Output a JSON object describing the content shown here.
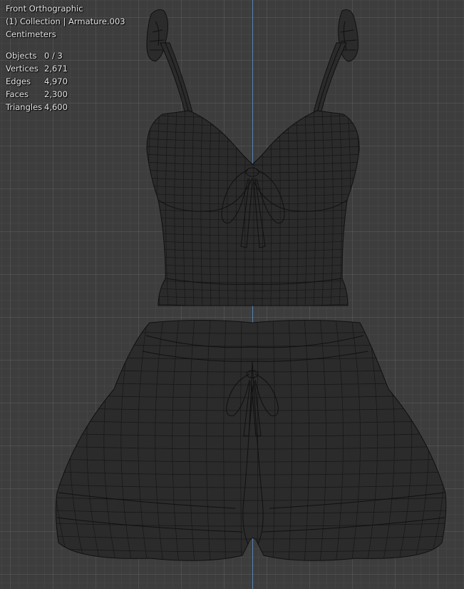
{
  "viewport": {
    "view_name": "Front Orthographic",
    "collection_info": "(1) Collection | Armature.003",
    "units": "Centimeters",
    "axis_color": "#5d8fc9",
    "background_color": "#3d3d3d"
  },
  "stats": [
    {
      "label": "Objects",
      "value": "0 / 3"
    },
    {
      "label": "Vertices",
      "value": "2,671"
    },
    {
      "label": "Edges",
      "value": "4,970"
    },
    {
      "label": "Faces",
      "value": "2,300"
    },
    {
      "label": "Triangles",
      "value": "4,600"
    }
  ]
}
